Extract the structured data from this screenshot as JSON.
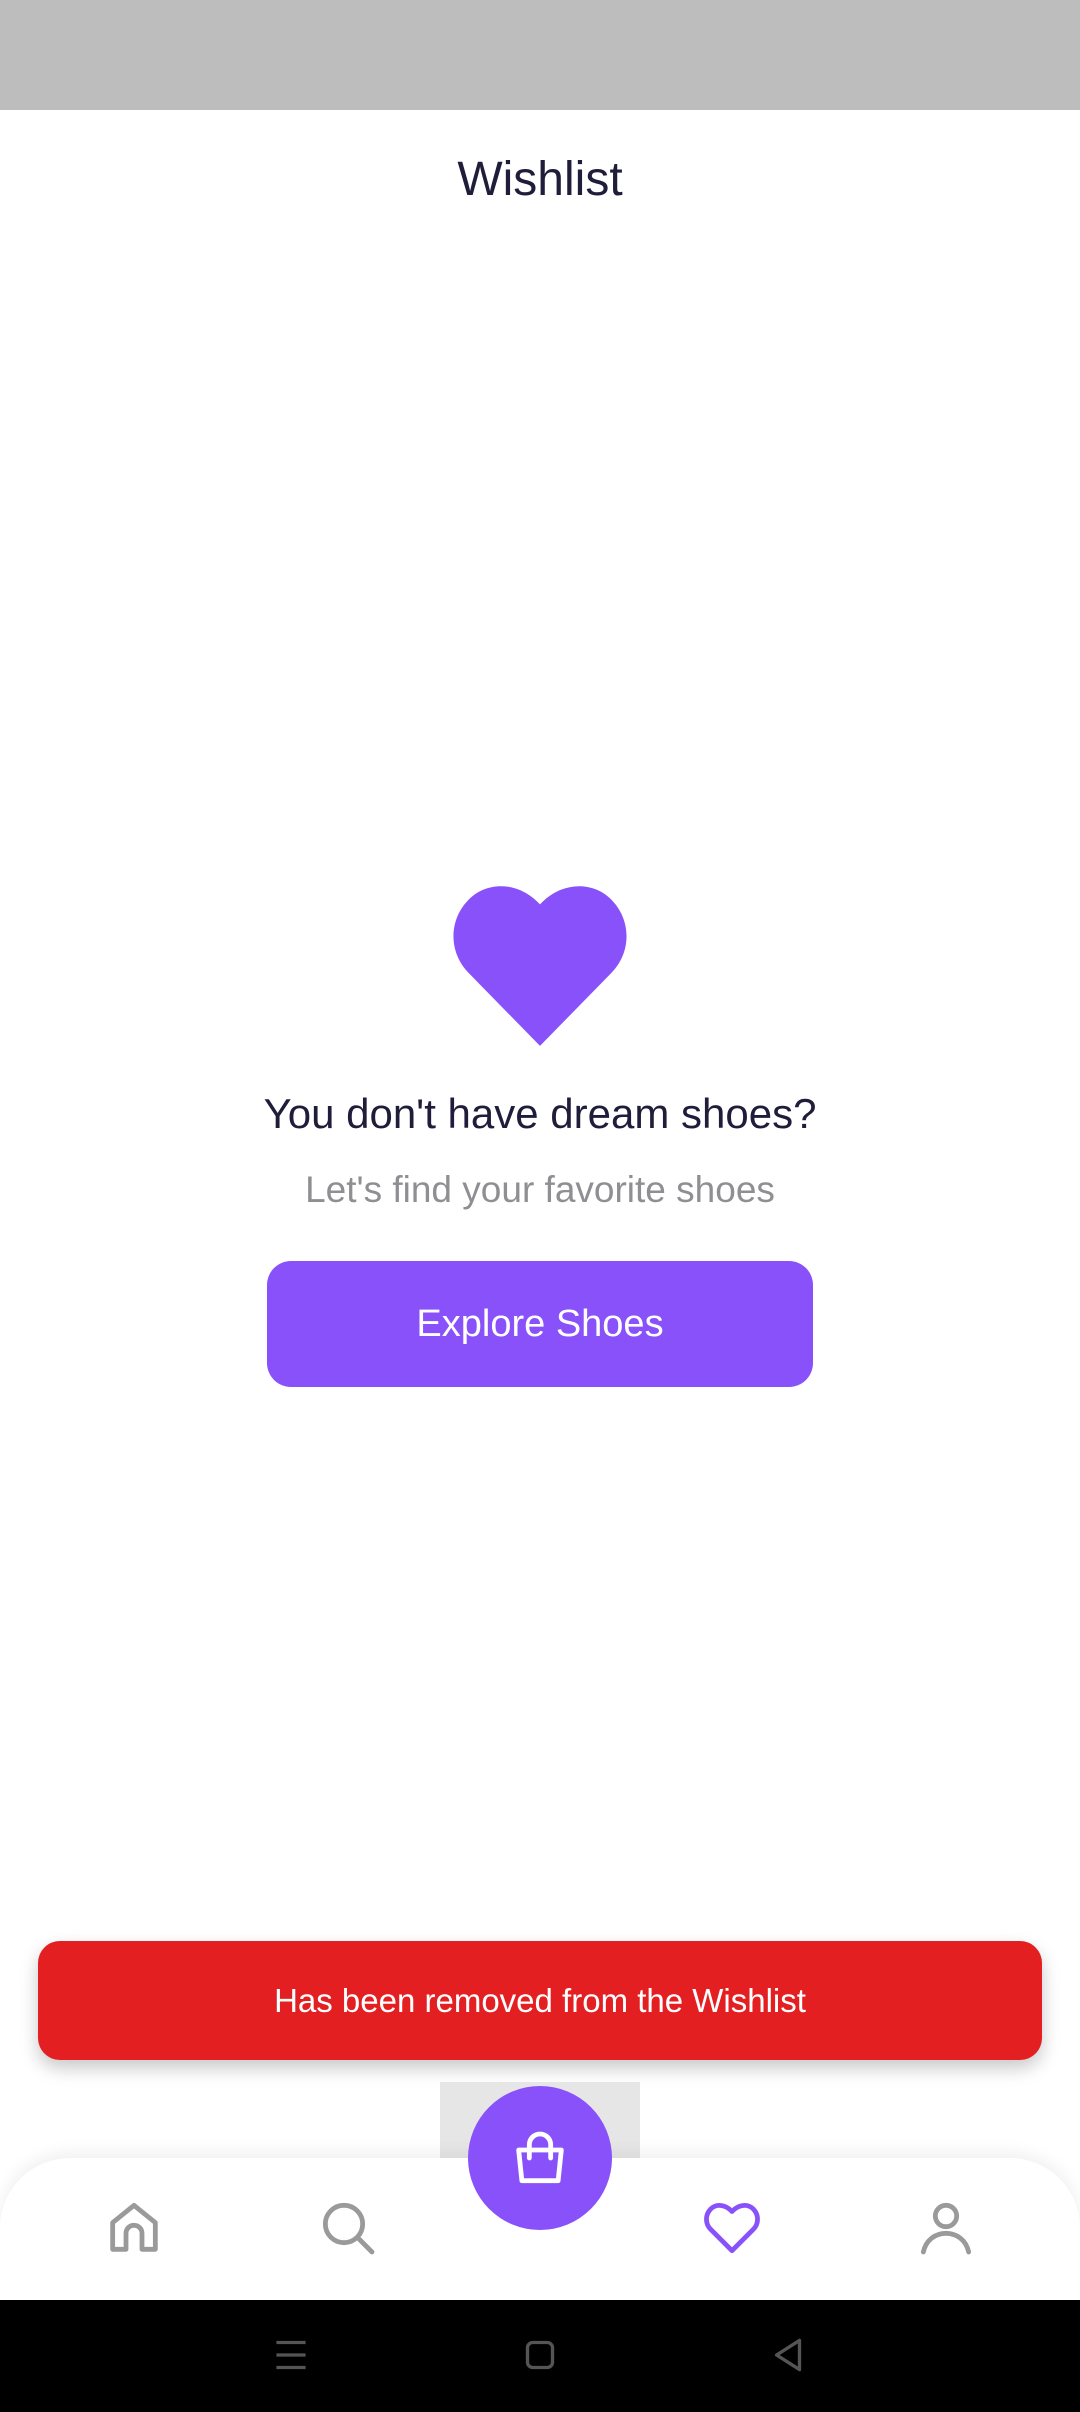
{
  "header": {
    "title": "Wishlist"
  },
  "empty_state": {
    "icon": "heart-icon",
    "title": "You don't have dream shoes?",
    "subtitle": "Let's find your favorite shoes",
    "button_label": "Explore Shoes"
  },
  "toast": {
    "message": "Has been removed from the Wishlist"
  },
  "bottom_nav": {
    "items": [
      {
        "icon": "home-icon",
        "active": false
      },
      {
        "icon": "search-icon",
        "active": false
      },
      {
        "icon": "shopping-bag-icon",
        "active": false
      },
      {
        "icon": "heart-icon",
        "active": true
      },
      {
        "icon": "user-icon",
        "active": false
      }
    ]
  },
  "system_nav": {
    "items": [
      {
        "icon": "menu-icon"
      },
      {
        "icon": "home-square-icon"
      },
      {
        "icon": "back-icon"
      }
    ]
  },
  "colors": {
    "accent": "#8851fa",
    "toast_bg": "#e41f22",
    "text_primary": "#1f1d3a",
    "text_secondary": "#8e8e93",
    "icon_inactive": "#9a9a9a",
    "status_bar": "#bdbdbd"
  }
}
